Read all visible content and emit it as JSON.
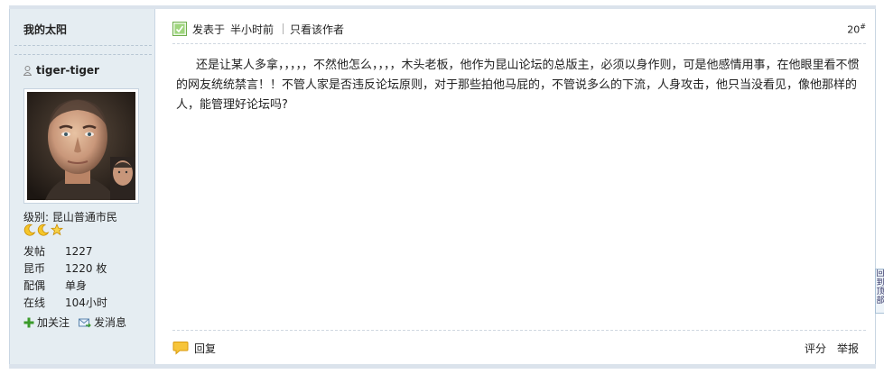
{
  "sidebar": {
    "title": "我的太阳",
    "username": "tiger-tiger",
    "level": "级别: 昆山普通市民",
    "level_icons": [
      "moon-icon",
      "moon-icon",
      "star-icon"
    ],
    "stats": [
      {
        "label": "发帖",
        "value": "1227"
      },
      {
        "label": "昆币",
        "value": "1220 枚"
      },
      {
        "label": "配偶",
        "value": "单身"
      },
      {
        "label": "在线",
        "value": "104小时"
      }
    ],
    "actions": {
      "follow_label": "加关注",
      "message_label": "发消息"
    }
  },
  "post": {
    "posted_prefix": "发表于",
    "posted_time": "半小时前",
    "author_only_label": "只看该作者",
    "floor_number": "20",
    "floor_symbol": "#",
    "body": "还是让某人多拿，，，，，不然他怎么，，，，木头老板，他作为昆山论坛的总版主，必须以身作则，可是他感情用事，在他眼里看不惯的网友统统禁言！！不管人家是否违反论坛原则，对于那些拍他马屁的，不管说多么的下流，人身攻击，他只当没看见，像他那样的人，能管理好论坛吗?"
  },
  "footer": {
    "reply_label": "回复",
    "rate_label": "评分",
    "report_label": "举报"
  },
  "side_tab": {
    "label": "回到顶部"
  },
  "colors": {
    "sidebar_bg": "#e5edf2",
    "border": "#c9d6e3",
    "icon_green": "#3a9a2a",
    "icon_orange": "#f0a810"
  }
}
